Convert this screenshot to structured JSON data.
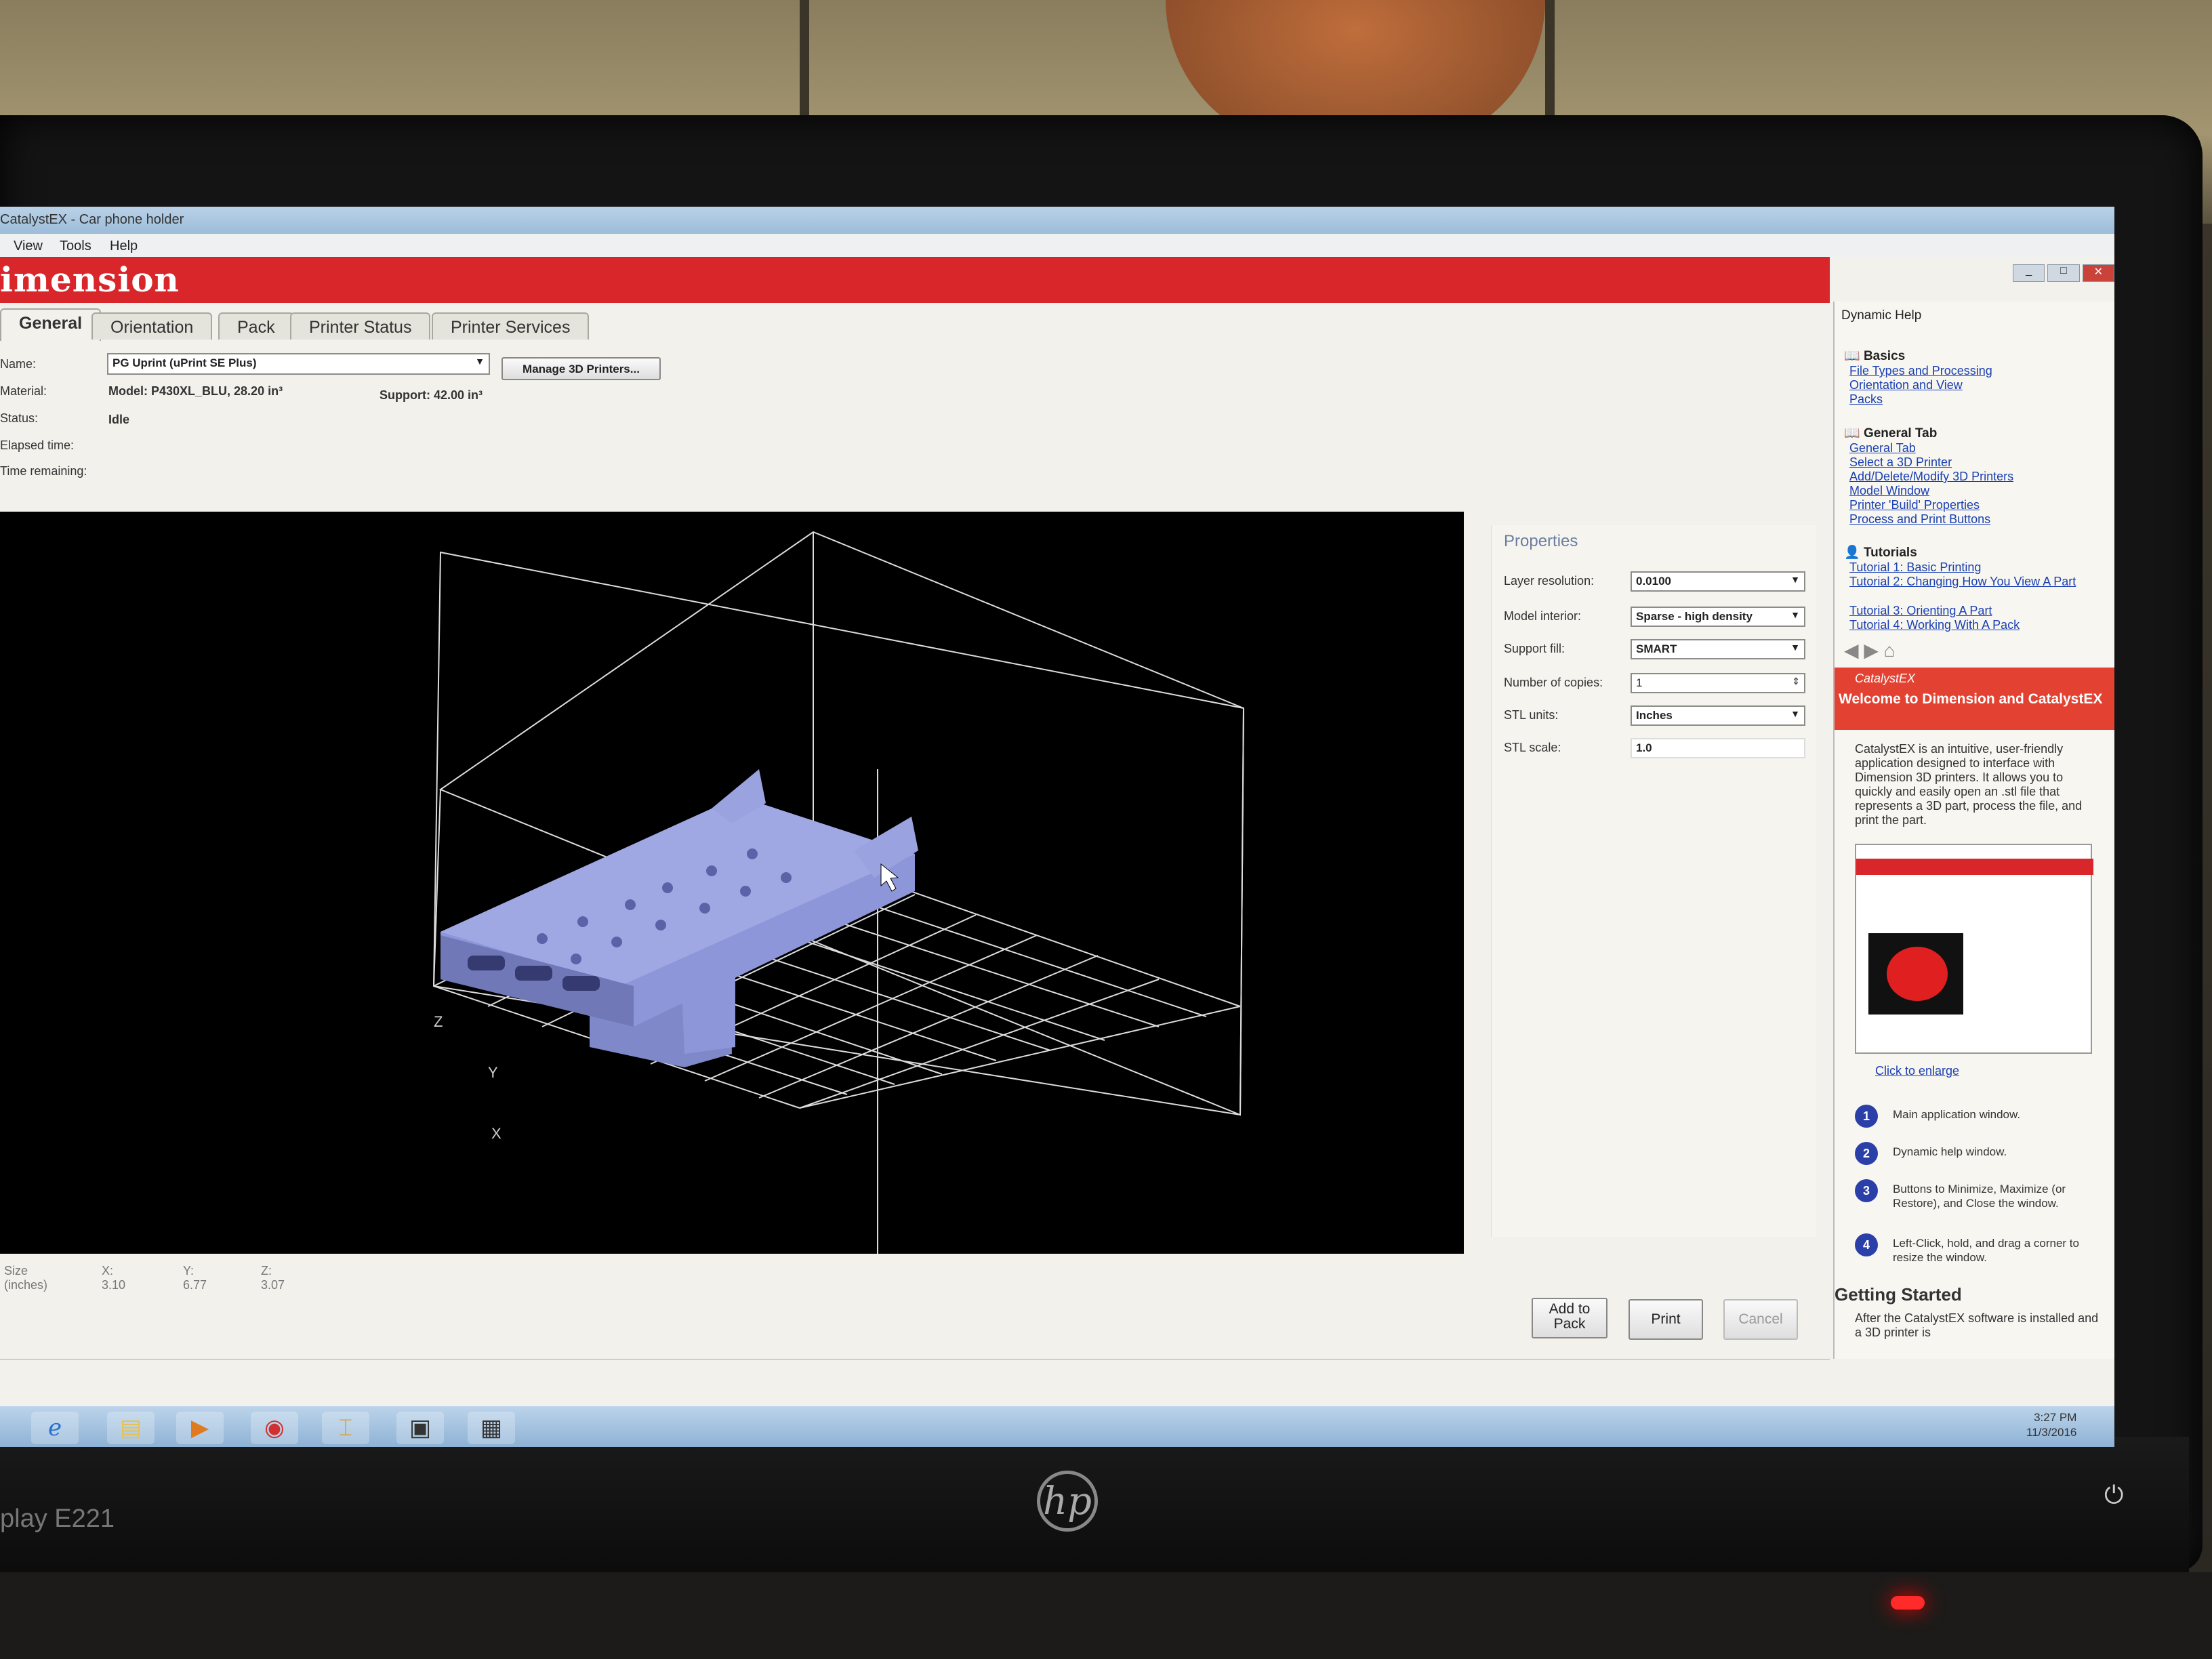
{
  "window": {
    "title": "CatalystEX - Car phone holder"
  },
  "menu": [
    "View",
    "Tools",
    "Help"
  ],
  "brand": {
    "logo": "imension"
  },
  "tabs": [
    "General",
    "Orientation",
    "Pack",
    "Printer Status",
    "Printer Services"
  ],
  "general": {
    "name_label": "Name:",
    "name_value": "PG Uprint  (uPrint SE Plus)",
    "manage_button": "Manage 3D Printers...",
    "material_label": "Material:",
    "model_value": "Model:  P430XL_BLU,  28.20 in³",
    "support_value": "Support:  42.00 in³",
    "status_label": "Status:",
    "status_value": "Idle",
    "elapsed_label": "Elapsed time:",
    "remaining_label": "Time remaining:"
  },
  "viewport": {
    "axis_z": "Z",
    "axis_y": "Y",
    "axis_x": "X",
    "size_label": "Size (inches)",
    "size_x": "X: 3.10",
    "size_y": "Y: 6.77",
    "size_z": "Z: 3.07"
  },
  "properties": {
    "title": "Properties",
    "rows": [
      {
        "label": "Layer resolution:",
        "value": "0.0100"
      },
      {
        "label": "Model interior:",
        "value": "Sparse - high density"
      },
      {
        "label": "Support fill:",
        "value": "SMART"
      },
      {
        "label": "Number of copies:",
        "value": "1"
      },
      {
        "label": "STL units:",
        "value": "Inches"
      },
      {
        "label": "STL scale:",
        "value": "1.0"
      }
    ]
  },
  "actions": {
    "add_to_pack": "Add to Pack",
    "print": "Print",
    "cancel": "Cancel"
  },
  "help": {
    "header": "Dynamic Help",
    "basics": "Basics",
    "basics_links": [
      "File Types and Processing",
      "Orientation and View",
      "Packs"
    ],
    "general_tab": "General Tab",
    "general_links": [
      "General Tab",
      "Select a 3D Printer",
      "Add/Delete/Modify 3D Printers",
      "Model Window",
      "Printer 'Build' Properties",
      "Process and Print Buttons"
    ],
    "tutorials": "Tutorials",
    "tutorial_links": [
      "Tutorial 1: Basic Printing",
      "Tutorial 2: Changing How You View A Part",
      "Tutorial 3: Orienting A Part",
      "Tutorial 4: Working With A Pack"
    ],
    "welcome_brand": "CatalystEX",
    "welcome_title": "Welcome to Dimension and CatalystEX",
    "intro": "CatalystEX is an intuitive, user-friendly application designed to interface with Dimension 3D printers. It allows you to quickly and easily open an .stl file that represents a 3D part, process the file, and print the part.",
    "enlarge": "Click to enlarge",
    "steps": [
      {
        "n": "1",
        "text": "Main application window."
      },
      {
        "n": "2",
        "text": "Dynamic help window."
      },
      {
        "n": "3",
        "text": "Buttons to Minimize, Maximize (or Restore), and Close the window."
      },
      {
        "n": "4",
        "text": "Left-Click, hold, and drag a corner to resize the window."
      }
    ],
    "getting_started": "Getting Started",
    "gs_text": "After the CatalystEX software is installed and a 3D printer is"
  },
  "taskbar": {
    "time": "3:27 PM",
    "date": "11/3/2016"
  },
  "monitor": {
    "model": "play E221",
    "brand": "hp"
  },
  "colors": {
    "brand_red": "#d9262b",
    "model_blue": "#8d96d8",
    "link_blue": "#1a3fb0"
  }
}
